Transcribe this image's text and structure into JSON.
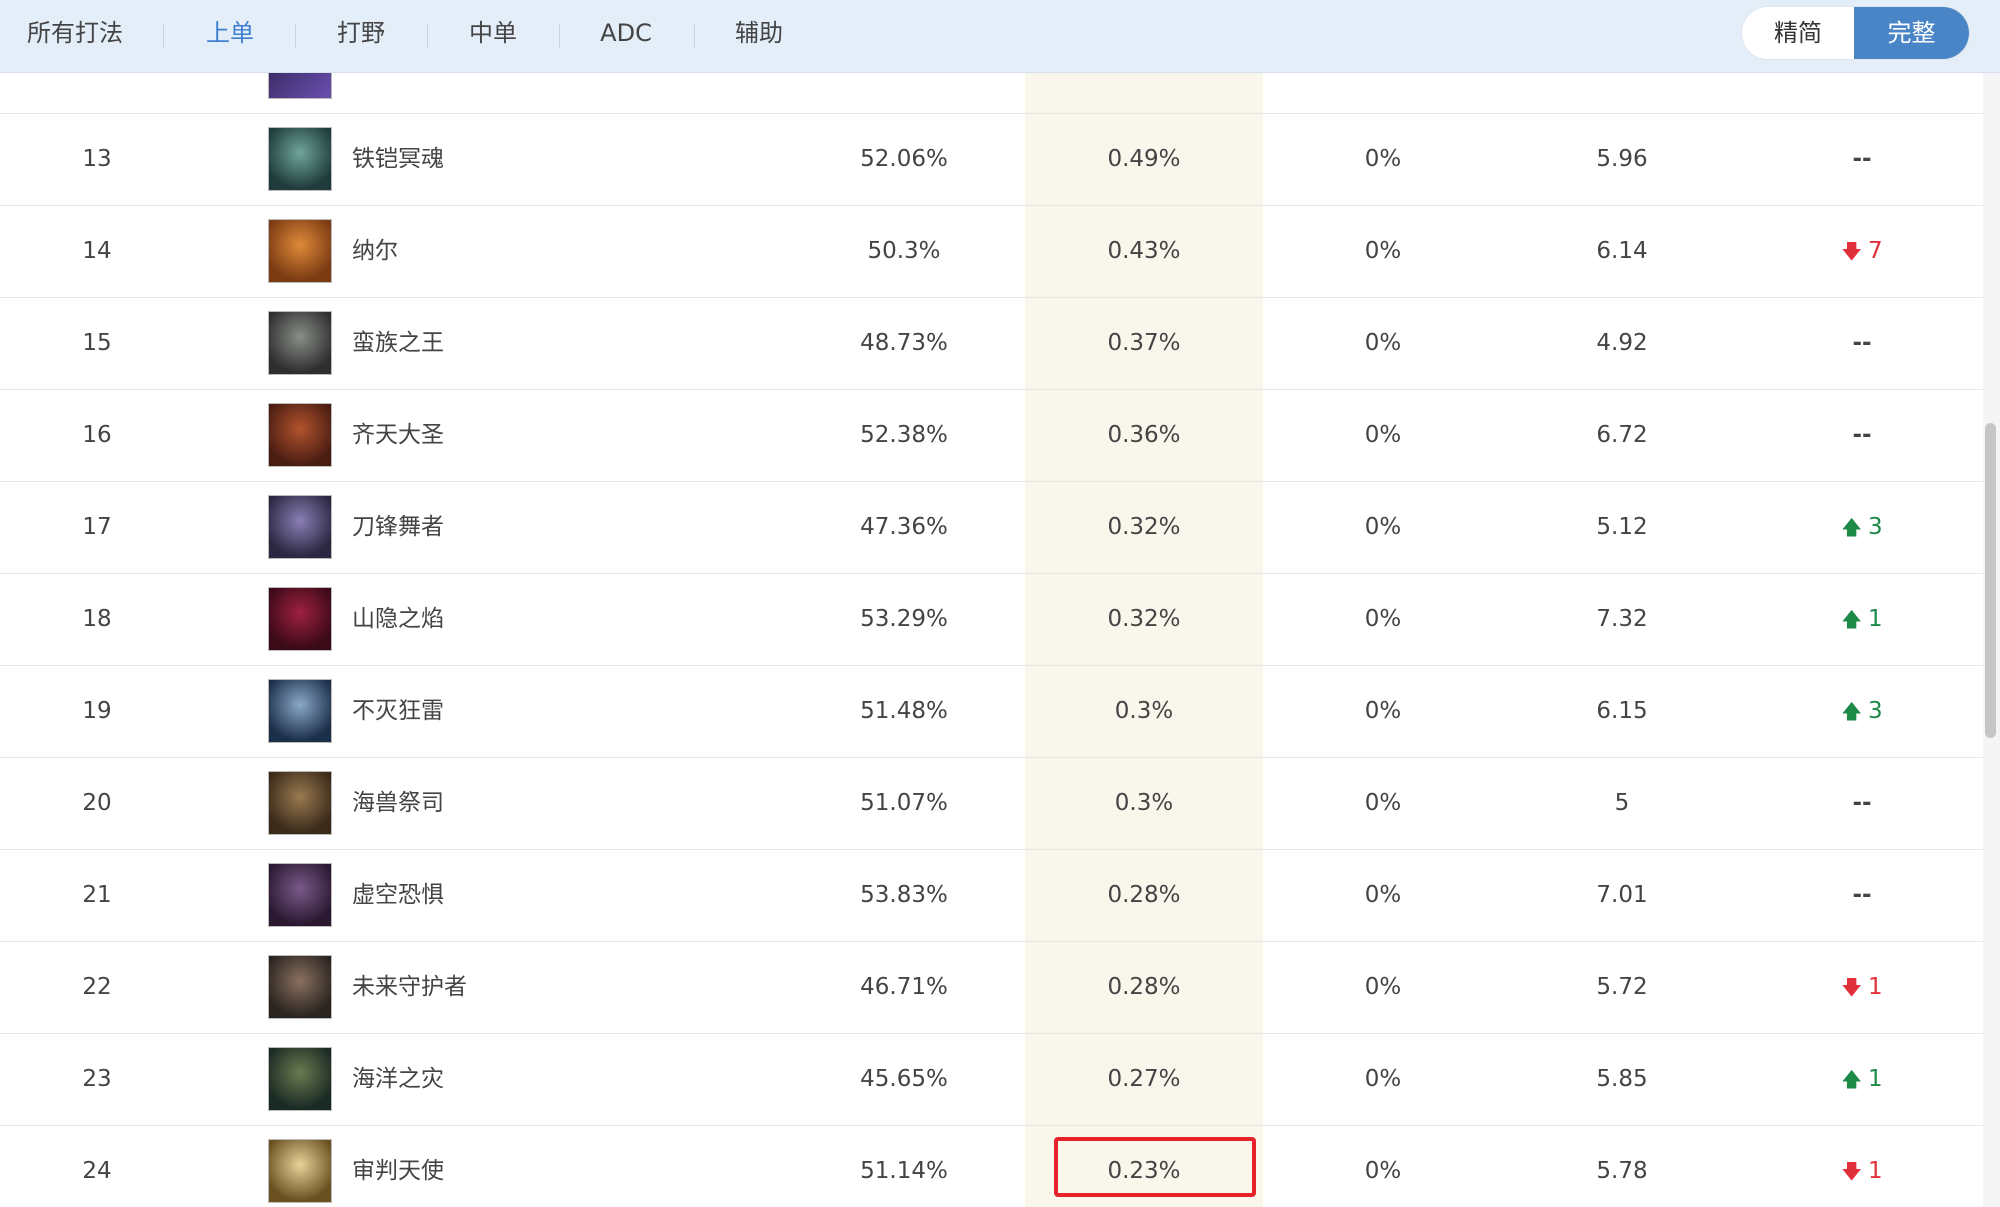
{
  "nav": {
    "tabs": [
      {
        "label": "所有打法"
      },
      {
        "label": "上单"
      },
      {
        "label": "打野"
      },
      {
        "label": "中单"
      },
      {
        "label": "ADC"
      },
      {
        "label": "辅助"
      }
    ],
    "active_tab": "上单",
    "view_toggle": {
      "simple": "精简",
      "full": "完整",
      "selected": "完整"
    }
  },
  "colors": {
    "accent": "#3e7fd0",
    "toggle_active": "#4a86c7",
    "highlight_column": "#f9f6ec",
    "trend_up": "#1d8a48",
    "trend_down": "#e0303a",
    "red_box": "#e8222b"
  },
  "rows": [
    {
      "rank": "13",
      "name": "铁铠冥魂",
      "win_rate": "52.06%",
      "pick_rate": "0.49%",
      "ban_rate": "0%",
      "kda": "5.96",
      "trend": "--",
      "trend_dir": "none"
    },
    {
      "rank": "14",
      "name": "纳尔",
      "win_rate": "50.3%",
      "pick_rate": "0.43%",
      "ban_rate": "0%",
      "kda": "6.14",
      "trend": "7",
      "trend_dir": "down"
    },
    {
      "rank": "15",
      "name": "蛮族之王",
      "win_rate": "48.73%",
      "pick_rate": "0.37%",
      "ban_rate": "0%",
      "kda": "4.92",
      "trend": "--",
      "trend_dir": "none"
    },
    {
      "rank": "16",
      "name": "齐天大圣",
      "win_rate": "52.38%",
      "pick_rate": "0.36%",
      "ban_rate": "0%",
      "kda": "6.72",
      "trend": "--",
      "trend_dir": "none"
    },
    {
      "rank": "17",
      "name": "刀锋舞者",
      "win_rate": "47.36%",
      "pick_rate": "0.32%",
      "ban_rate": "0%",
      "kda": "5.12",
      "trend": "3",
      "trend_dir": "up"
    },
    {
      "rank": "18",
      "name": "山隐之焰",
      "win_rate": "53.29%",
      "pick_rate": "0.32%",
      "ban_rate": "0%",
      "kda": "7.32",
      "trend": "1",
      "trend_dir": "up"
    },
    {
      "rank": "19",
      "name": "不灭狂雷",
      "win_rate": "51.48%",
      "pick_rate": "0.3%",
      "ban_rate": "0%",
      "kda": "6.15",
      "trend": "3",
      "trend_dir": "up"
    },
    {
      "rank": "20",
      "name": "海兽祭司",
      "win_rate": "51.07%",
      "pick_rate": "0.3%",
      "ban_rate": "0%",
      "kda": "5",
      "trend": "--",
      "trend_dir": "none"
    },
    {
      "rank": "21",
      "name": "虚空恐惧",
      "win_rate": "53.83%",
      "pick_rate": "0.28%",
      "ban_rate": "0%",
      "kda": "7.01",
      "trend": "--",
      "trend_dir": "none"
    },
    {
      "rank": "22",
      "name": "未来守护者",
      "win_rate": "46.71%",
      "pick_rate": "0.28%",
      "ban_rate": "0%",
      "kda": "5.72",
      "trend": "1",
      "trend_dir": "down"
    },
    {
      "rank": "23",
      "name": "海洋之灾",
      "win_rate": "45.65%",
      "pick_rate": "0.27%",
      "ban_rate": "0%",
      "kda": "5.85",
      "trend": "1",
      "trend_dir": "up"
    },
    {
      "rank": "24",
      "name": "审判天使",
      "win_rate": "51.14%",
      "pick_rate": "0.23%",
      "ban_rate": "0%",
      "kda": "5.78",
      "trend": "1",
      "trend_dir": "down"
    }
  ]
}
